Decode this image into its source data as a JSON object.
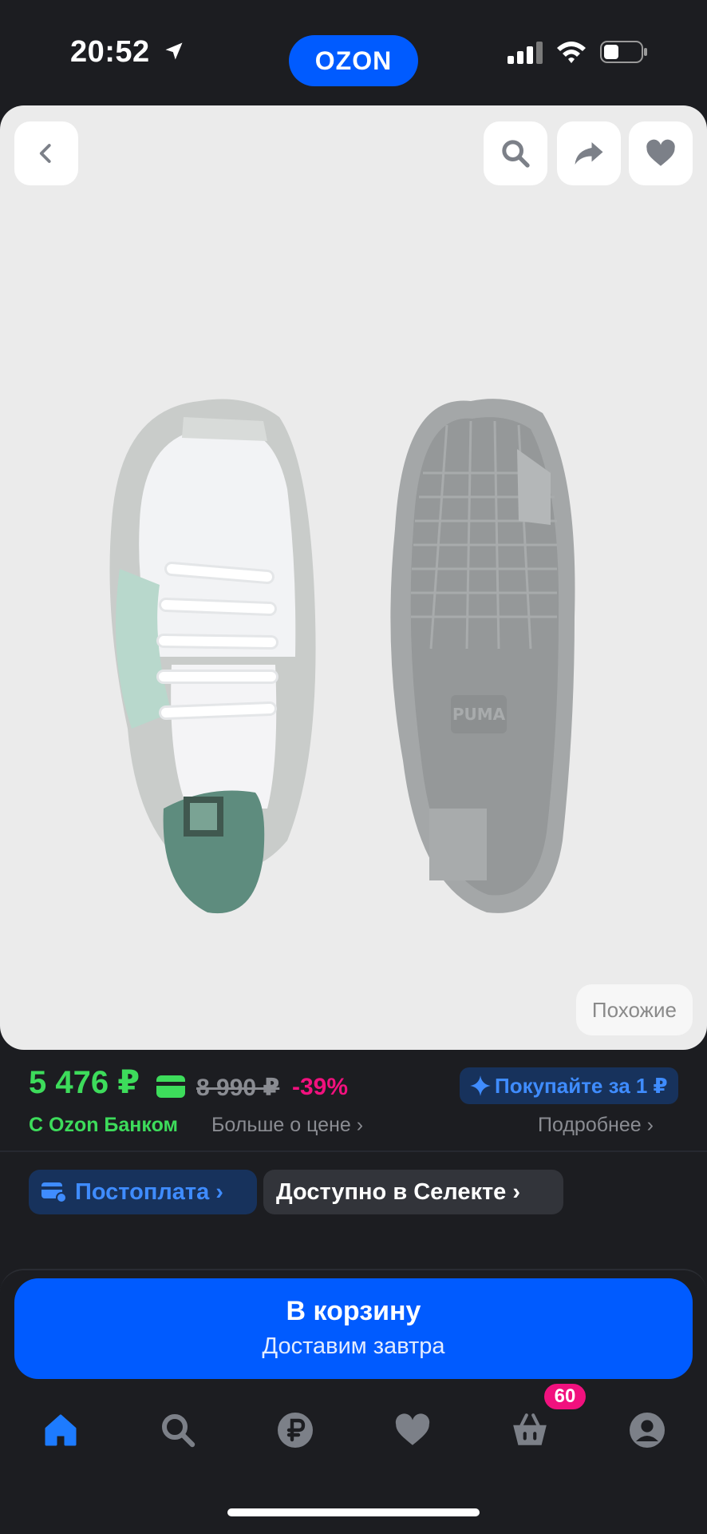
{
  "status_bar": {
    "time": "20:52",
    "icons": [
      "location-arrow-icon",
      "signal-icon",
      "wifi-icon",
      "battery-icon"
    ]
  },
  "header": {
    "logo": "OZON"
  },
  "image_toolbar": {
    "icons": [
      "chevron-left-icon",
      "search-icon",
      "share-icon",
      "heart-icon"
    ],
    "similar_label": "Похожие",
    "brand_mark": "PUMA"
  },
  "price": {
    "current": "5 476 ₽",
    "old": "8 990 ₽",
    "discount": "-39%",
    "bank_label": "С Ozon Банком",
    "more_about_price": "Больше о цене",
    "promo_label": "Покупайте за 1 ₽",
    "details_link": "Подробнее"
  },
  "chips": {
    "postpay": "Постоплата",
    "select": "Доступно в Селекте"
  },
  "cart_button": {
    "title": "В корзину",
    "subtitle": "Доставим завтра"
  },
  "tabbar": {
    "items": [
      "home-icon",
      "search-icon",
      "ruble-icon",
      "heart-icon",
      "basket-icon",
      "profile-icon"
    ],
    "cart_badge": "60"
  },
  "colors": {
    "brand_blue": "#005bff",
    "price_green": "#3ddc5b",
    "discount_pink": "#f1117e",
    "background": "#1c1d21"
  }
}
